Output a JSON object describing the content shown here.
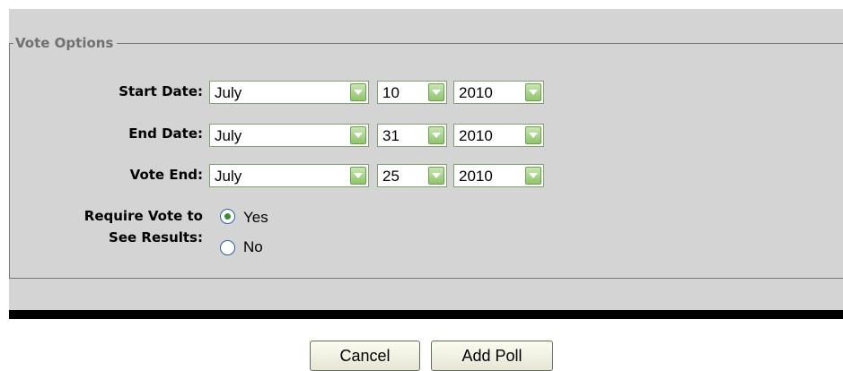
{
  "fieldset": {
    "legend": "Vote Options"
  },
  "rows": [
    {
      "label": "Start Date:",
      "month": "July",
      "day": "10",
      "year": "2010"
    },
    {
      "label": "End Date:",
      "month": "July",
      "day": "31",
      "year": "2010"
    },
    {
      "label": "Vote End:",
      "month": "July",
      "day": "25",
      "year": "2010"
    }
  ],
  "require_vote": {
    "label_line1": "Require Vote to",
    "label_line2": "See Results:",
    "options": [
      {
        "label": "Yes",
        "selected": true
      },
      {
        "label": "No",
        "selected": false
      }
    ]
  },
  "buttons": {
    "cancel": "Cancel",
    "add_poll": "Add Poll"
  },
  "colors": {
    "panel_bg": "#d4d4d4",
    "select_border": "#7fa16c",
    "dropdown_button": "#8fc46c"
  }
}
